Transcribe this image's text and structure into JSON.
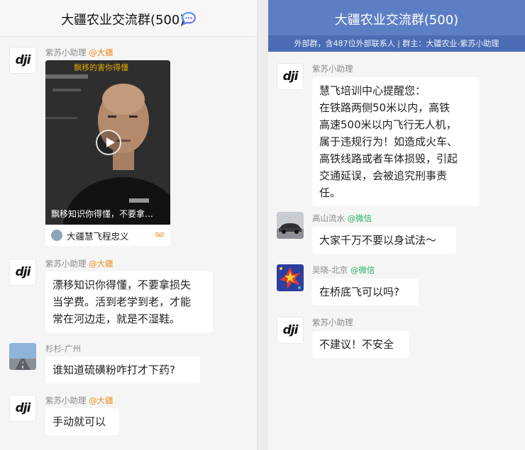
{
  "left": {
    "title": "大疆农业交流群(500)",
    "messages": [
      {
        "sender": "紫苏小助理",
        "tag": "@大疆",
        "video": {
          "overlay_top": "飘移的害你得懂",
          "caption": "飘移知识你得懂，不要拿…",
          "channel": "大疆慧飞程忠义"
        }
      },
      {
        "sender": "紫苏小助理",
        "tag": "@大疆",
        "text_lines": [
          "漂移知识你得懂，不要拿损失",
          "当学费。活到老学到老，才能",
          "常在河边走，就是不湿鞋。"
        ]
      },
      {
        "sender": "杉杉-广州",
        "tag": "",
        "text_lines": [
          "谁知道硫磺粉咋打才下药?"
        ]
      },
      {
        "sender": "紫苏小助理",
        "tag": "@大疆",
        "text_lines": [
          "手动就可以"
        ]
      }
    ]
  },
  "right": {
    "title": "大疆农业交流群(500)",
    "subtitle": "外部群，含487位外部联系人 | 群主：大疆农业-紫苏小助理",
    "messages": [
      {
        "sender": "紫苏小助理",
        "tag": "",
        "text_lines": [
          "慧飞培训中心提醒您：",
          "在铁路两侧50米以内，高铁",
          "高速500米以内飞行无人机，",
          "属于违规行为！如造成火车、",
          "高铁线路或者车体损毁，引起",
          "交通延误，会被追究刑事责",
          "任。"
        ]
      },
      {
        "sender": "高山流水",
        "tag": "@微信",
        "text_lines": [
          "大家千万不要以身试法～"
        ]
      },
      {
        "sender": "吴晓-北京",
        "tag": "@微信",
        "text_lines": [
          "在桥底飞可以吗?"
        ]
      },
      {
        "sender": "紫苏小助理",
        "tag": "",
        "text_lines": [
          "不建议！不安全"
        ]
      }
    ]
  },
  "logo_text": "dji",
  "colors": {
    "header_blue": "#5c7ec4",
    "subheader_blue": "#4b6db5",
    "tag_orange": "#f08c1e",
    "tag_green": "#2aae67"
  }
}
